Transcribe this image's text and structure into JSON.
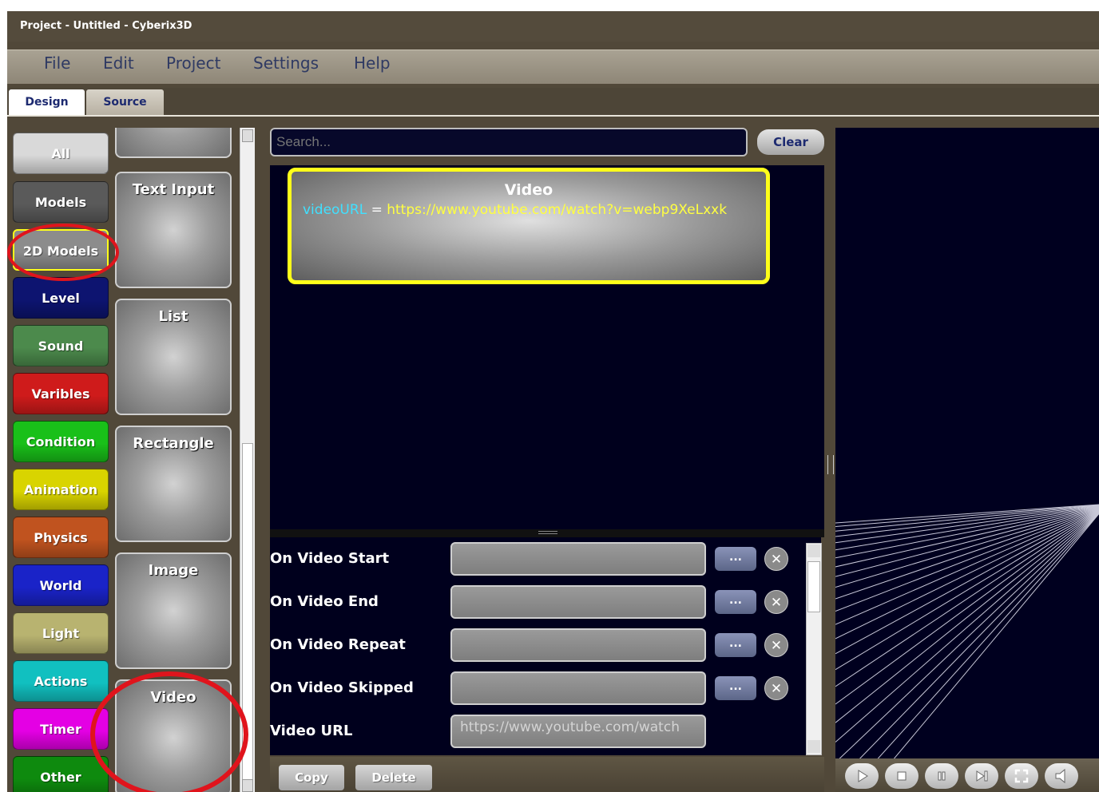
{
  "window": {
    "title": "Project - Untitled - Cyberix3D"
  },
  "menu": [
    "File",
    "Edit",
    "Project",
    "Settings",
    "Help"
  ],
  "tabs": {
    "design": "Design",
    "source": "Source"
  },
  "categories": [
    {
      "label": "All",
      "color": "#d9d9d9"
    },
    {
      "label": "Models",
      "color": "#5a5a5a"
    },
    {
      "label": "2D Models",
      "color": "#8c8c8c"
    },
    {
      "label": "Level",
      "color": "#0d1470"
    },
    {
      "label": "Sound",
      "color": "#4c8a4c"
    },
    {
      "label": "Varibles",
      "color": "#cf1b1b"
    },
    {
      "label": "Condition",
      "color": "#19c019"
    },
    {
      "label": "Animation",
      "color": "#d9d400"
    },
    {
      "label": "Physics",
      "color": "#c0531f"
    },
    {
      "label": "World",
      "color": "#1a23c8"
    },
    {
      "label": "Light",
      "color": "#b8b370"
    },
    {
      "label": "Actions",
      "color": "#11c0c0"
    },
    {
      "label": "Timer",
      "color": "#e400e4"
    },
    {
      "label": "Other",
      "color": "#0e8a0e"
    }
  ],
  "components": [
    "Text Input",
    "List",
    "Rectangle",
    "Image",
    "Video"
  ],
  "search": {
    "placeholder": "Search...",
    "clear_label": "Clear"
  },
  "node": {
    "title": "Video",
    "prop_name": "videoURL",
    "prop_eq": "=",
    "prop_value": "https://www.youtube.com/watch?v=webp9XeLxxk"
  },
  "properties": [
    {
      "label": "On Video Start",
      "dots": "..."
    },
    {
      "label": "On Video End",
      "dots": "..."
    },
    {
      "label": "On Video Repeat",
      "dots": "..."
    },
    {
      "label": "On Video Skipped",
      "dots": "..."
    }
  ],
  "video_url": {
    "label": "Video URL",
    "value": "https://www.youtube.com/watch"
  },
  "bottom": {
    "copy": "Copy",
    "delete": "Delete"
  },
  "colors": {
    "highlight": "#ffff1a",
    "annotation": "#e0141c",
    "canvas": "#00001d",
    "prop_name": "#40e0ff",
    "prop_value": "#ffff40"
  }
}
